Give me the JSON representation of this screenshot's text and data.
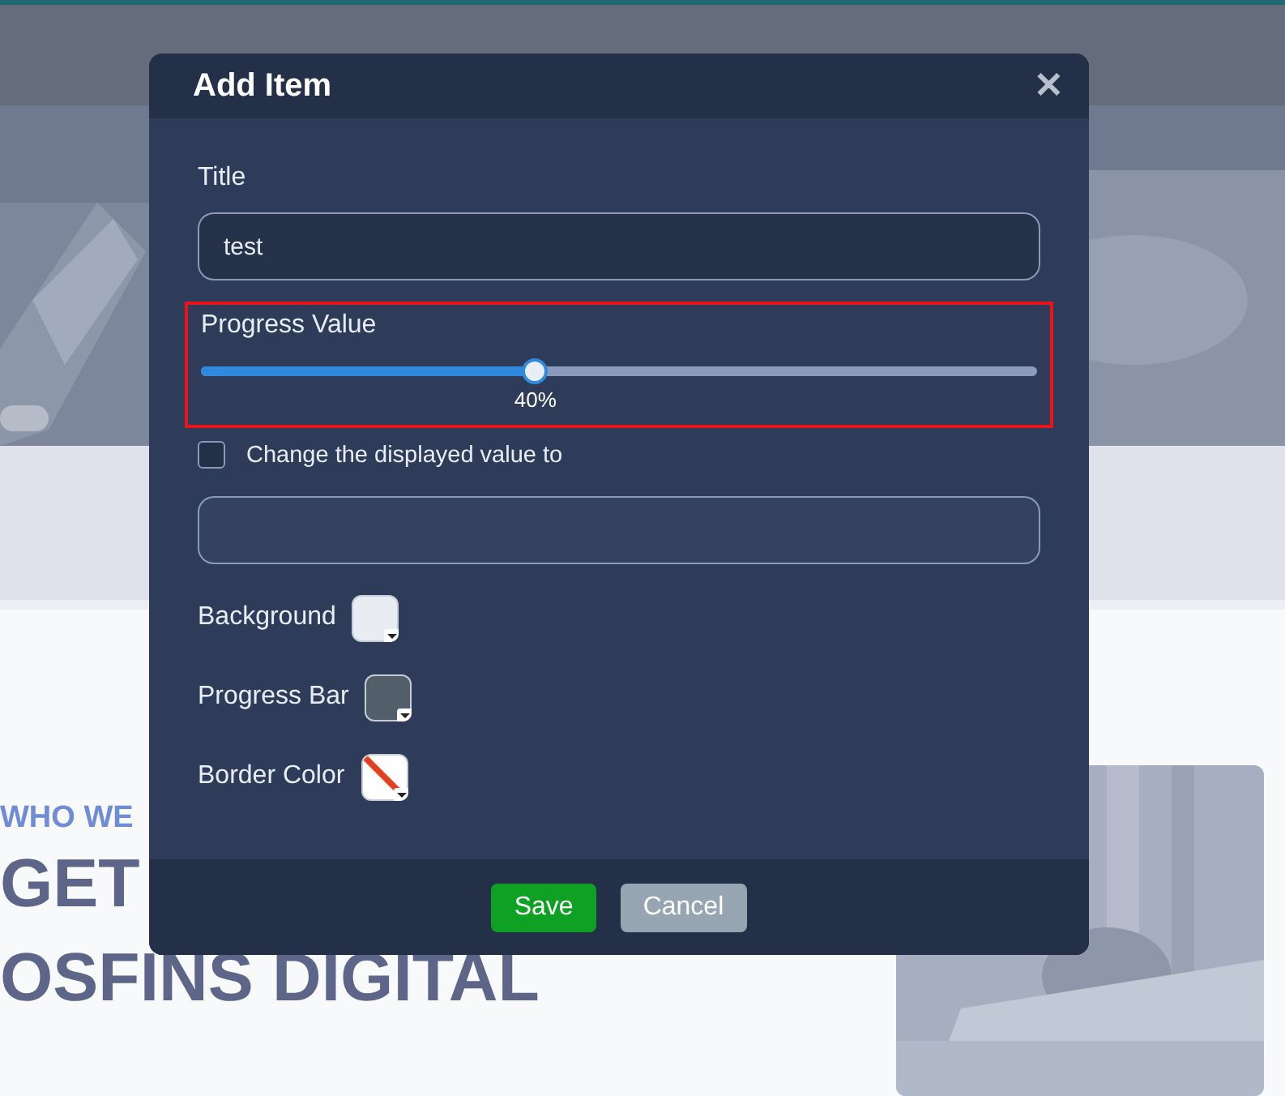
{
  "background_page": {
    "eyebrow": "WHO WE",
    "headline_lines": [
      "GET",
      "OSFINS DIGITAL"
    ]
  },
  "dialog": {
    "title": "Add Item",
    "close_label": "✕",
    "title_field": {
      "label": "Title",
      "value": "test"
    },
    "progress": {
      "label": "Progress Value",
      "level": 0.4,
      "reading": "40%",
      "highlighted": true
    },
    "override": {
      "label": "Change the displayed value to",
      "checked": false
    },
    "colors": [
      {
        "label": "Background",
        "kind": "solid",
        "color": "#e9ecf0"
      },
      {
        "label": "Progress Bar",
        "kind": "solid",
        "color": "#535e6b"
      },
      {
        "label": "Border Color",
        "kind": "none"
      }
    ],
    "buttons": [
      {
        "label": "Save",
        "kind": "primary"
      },
      {
        "label": "Cancel",
        "kind": "secondary"
      }
    ]
  }
}
